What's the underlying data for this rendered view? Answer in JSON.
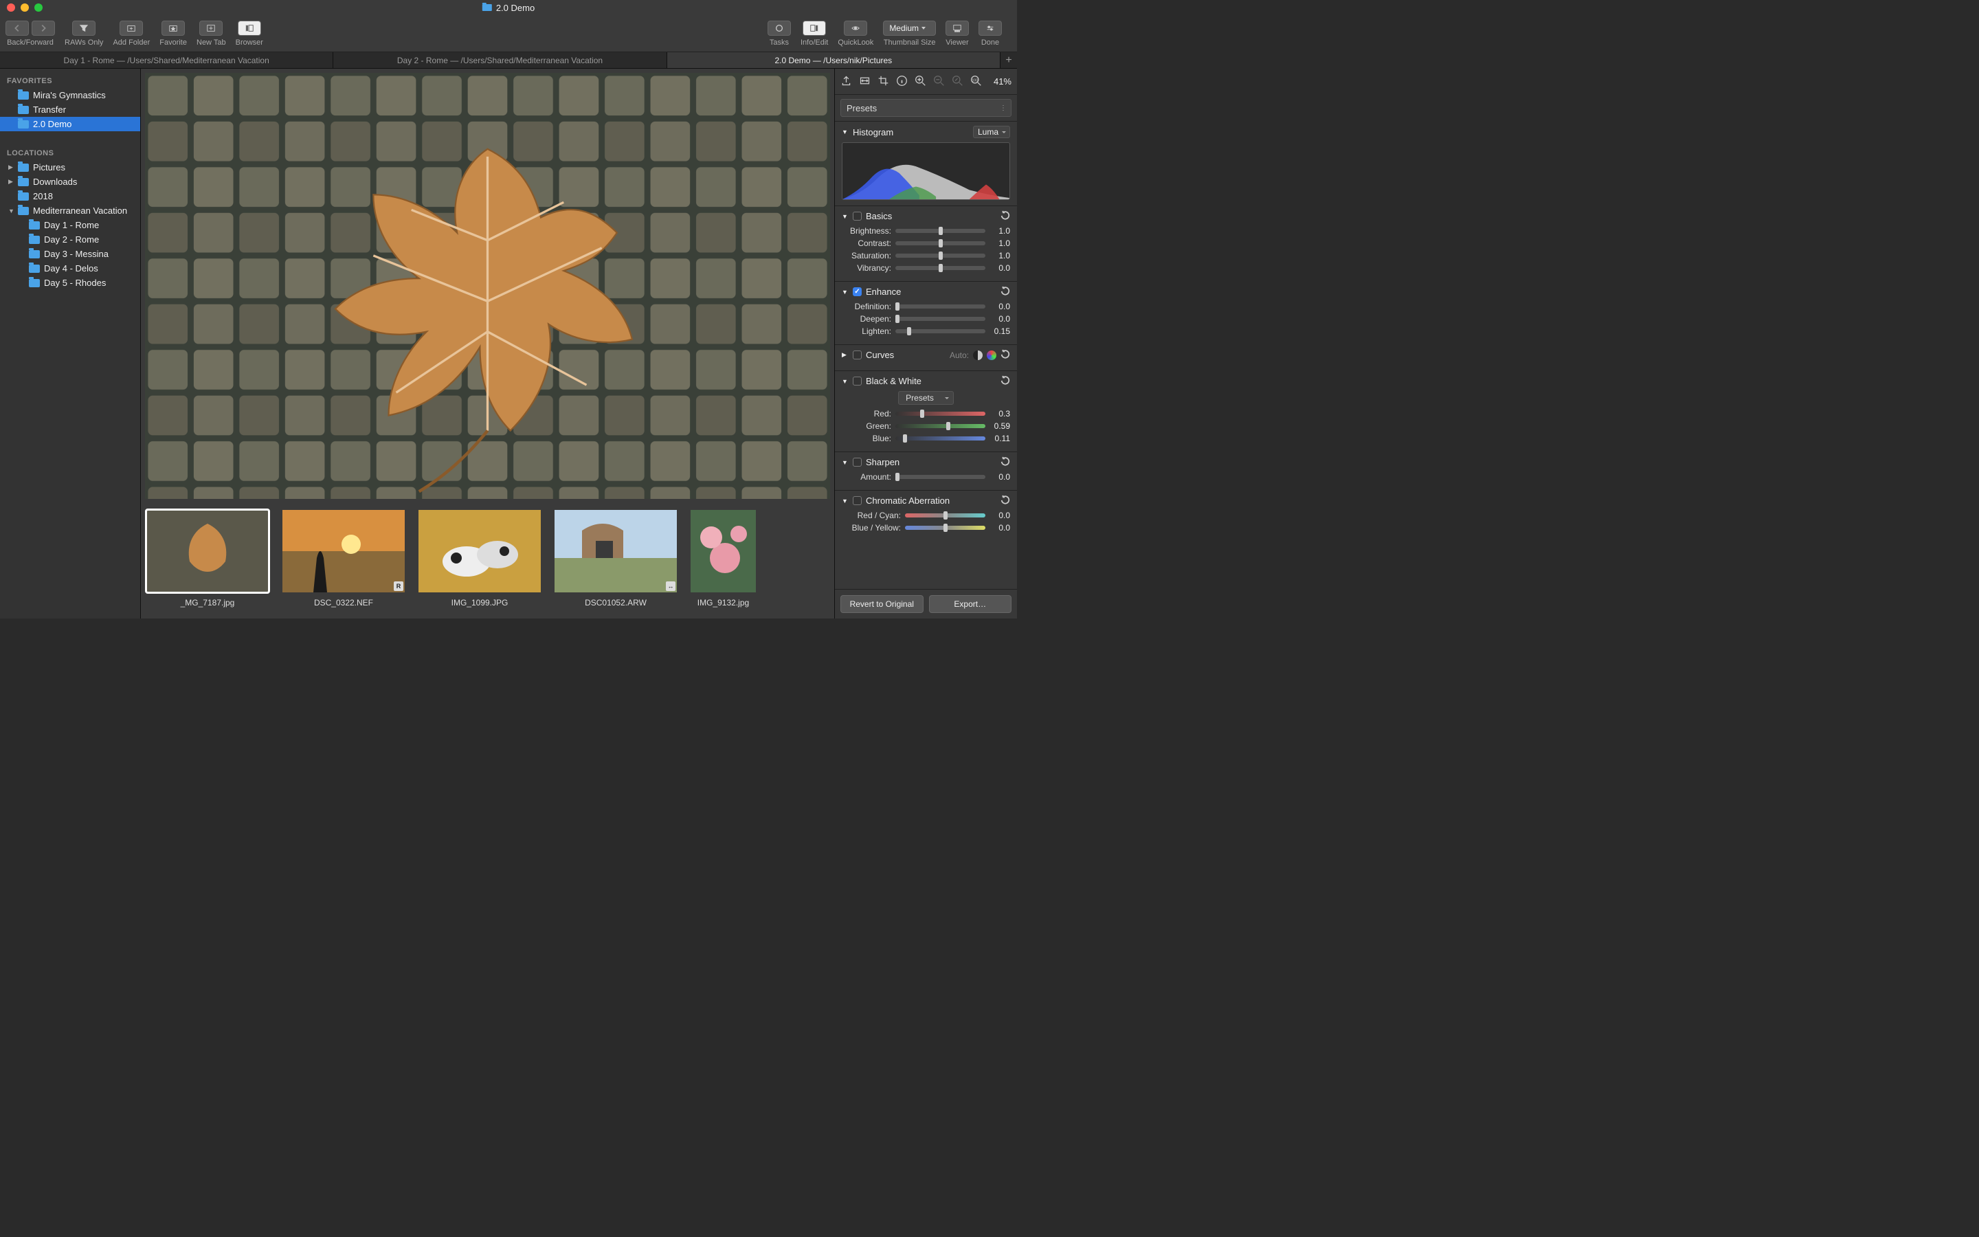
{
  "window": {
    "title": "2.0 Demo"
  },
  "toolbar": {
    "back_forward": "Back/Forward",
    "raws_only": "RAWs Only",
    "add_folder": "Add Folder",
    "favorite": "Favorite",
    "new_tab": "New Tab",
    "browser": "Browser",
    "tasks": "Tasks",
    "info_edit": "Info/Edit",
    "quicklook": "QuickLook",
    "thumbnail_size": "Thumbnail Size",
    "thumbnail_value": "Medium",
    "viewer": "Viewer",
    "done": "Done"
  },
  "tabs": [
    {
      "label": "Day 1 - Rome  —  /Users/Shared/Mediterranean Vacation",
      "active": false
    },
    {
      "label": "Day 2 - Rome  —  /Users/Shared/Mediterranean Vacation",
      "active": false
    },
    {
      "label": "2.0 Demo  —  /Users/nik/Pictures",
      "active": true
    }
  ],
  "sidebar": {
    "favorites_header": "FAVORITES",
    "favorites": [
      "Mira's Gymnastics",
      "Transfer",
      "2.0 Demo"
    ],
    "favorites_selected": 2,
    "locations_header": "LOCATIONS",
    "locations": [
      {
        "label": "Pictures",
        "indent": 0,
        "disclosure": "▶"
      },
      {
        "label": "Downloads",
        "indent": 0,
        "disclosure": "▶"
      },
      {
        "label": "2018",
        "indent": 0,
        "disclosure": ""
      },
      {
        "label": "Mediterranean Vacation",
        "indent": 0,
        "disclosure": "▼"
      },
      {
        "label": "Day 1 - Rome",
        "indent": 1,
        "disclosure": ""
      },
      {
        "label": "Day 2 - Rome",
        "indent": 1,
        "disclosure": ""
      },
      {
        "label": "Day 3 - Messina",
        "indent": 1,
        "disclosure": ""
      },
      {
        "label": "Day 4 - Delos",
        "indent": 1,
        "disclosure": ""
      },
      {
        "label": "Day 5 - Rhodes",
        "indent": 1,
        "disclosure": ""
      }
    ]
  },
  "filmstrip": [
    {
      "caption": "_MG_7187.jpg",
      "selected": true,
      "badge": ""
    },
    {
      "caption": "DSC_0322.NEF",
      "selected": false,
      "badge": "R"
    },
    {
      "caption": "IMG_1099.JPG",
      "selected": false,
      "badge": ""
    },
    {
      "caption": "DSC01052.ARW",
      "selected": false,
      "badge": "↔"
    },
    {
      "caption": "IMG_9132.jpg",
      "selected": false,
      "badge": ""
    }
  ],
  "rpanel": {
    "zoom": "41%",
    "presets_label": "Presets",
    "histogram": {
      "title": "Histogram",
      "mode": "Luma"
    },
    "basics": {
      "title": "Basics",
      "brightness": {
        "label": "Brightness:",
        "value": "1.0",
        "pos": 50
      },
      "contrast": {
        "label": "Contrast:",
        "value": "1.0",
        "pos": 50
      },
      "saturation": {
        "label": "Saturation:",
        "value": "1.0",
        "pos": 50
      },
      "vibrancy": {
        "label": "Vibrancy:",
        "value": "0.0",
        "pos": 50
      }
    },
    "enhance": {
      "title": "Enhance",
      "checked": true,
      "definition": {
        "label": "Definition:",
        "value": "0.0",
        "pos": 0
      },
      "deepen": {
        "label": "Deepen:",
        "value": "0.0",
        "pos": 0
      },
      "lighten": {
        "label": "Lighten:",
        "value": "0.15",
        "pos": 15
      }
    },
    "curves": {
      "title": "Curves",
      "auto_label": "Auto:"
    },
    "bw": {
      "title": "Black & White",
      "presets_label": "Presets",
      "red": {
        "label": "Red:",
        "value": "0.3",
        "pos": 30
      },
      "green": {
        "label": "Green:",
        "value": "0.59",
        "pos": 59
      },
      "blue": {
        "label": "Blue:",
        "value": "0.11",
        "pos": 11
      }
    },
    "sharpen": {
      "title": "Sharpen",
      "amount": {
        "label": "Amount:",
        "value": "0.0",
        "pos": 0
      }
    },
    "ca": {
      "title": "Chromatic Aberration",
      "red_cyan": {
        "label": "Red / Cyan:",
        "value": "0.0",
        "pos": 50
      },
      "blue_yellow": {
        "label": "Blue / Yellow:",
        "value": "0.0",
        "pos": 50
      }
    },
    "footer": {
      "revert": "Revert to Original",
      "export": "Export…"
    }
  }
}
